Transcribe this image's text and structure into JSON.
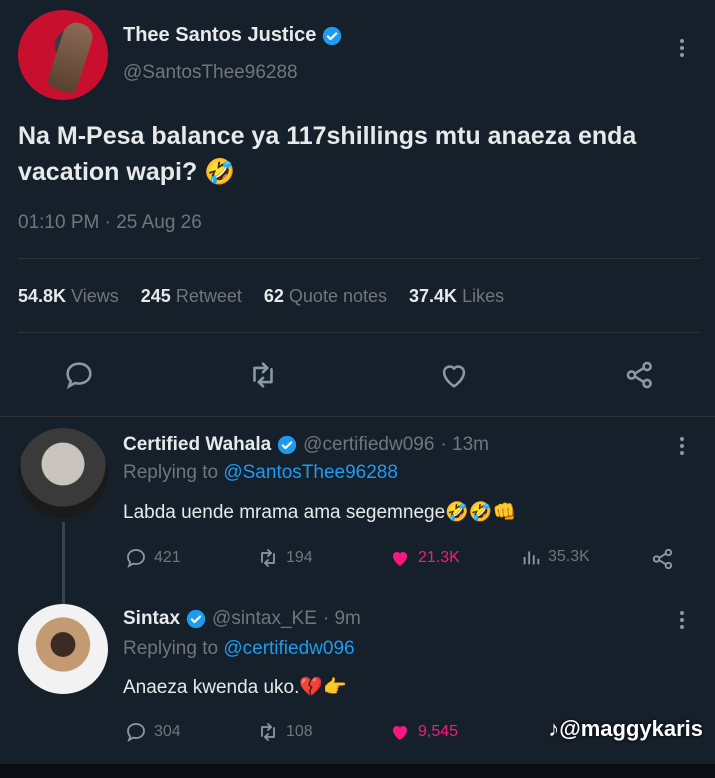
{
  "main_tweet": {
    "author_name": "Thee Santos Justice",
    "author_handle": "@SantosThee96288",
    "text_line1": "Na M-Pesa balance ya 117shillings mtu anaeza enda",
    "text_line2": "vacation wapi?",
    "emoji": "🤣",
    "timestamp": "01:10 PM · 25 Aug 26",
    "stats": [
      {
        "value": "54.8K",
        "label": "Views"
      },
      {
        "value": "245",
        "label": "Retweet"
      },
      {
        "value": "62",
        "label": "Quote notes"
      },
      {
        "value": "37.4K",
        "label": "Likes"
      }
    ],
    "icons": [
      "reply-icon",
      "retweet-icon",
      "like-icon",
      "share-icon"
    ]
  },
  "replies": [
    {
      "name": "Certified Wahala",
      "handle": "@certifiedw096",
      "time": "· 13m",
      "replying_label": "Replying to",
      "replying_to": "@SantosThee96288",
      "text": "Labda uende mrama ama segemnege",
      "emojis": "🤣🤣👊",
      "replies": "421",
      "retweets": "194",
      "likes": "21.3K",
      "views": "35.3K"
    },
    {
      "name": "Sintax",
      "handle": "@sintax_KE",
      "time": "· 9m",
      "replying_label": "Replying to",
      "replying_to": "@certifiedw096",
      "text": "Anaeza kwenda uko.",
      "emojis": "💔👉",
      "replies": "304",
      "retweets": "108",
      "likes": "9,545"
    }
  ],
  "watermark": "@maggykaris",
  "colors": {
    "background": "#15202b",
    "accent": "#1d9bf0",
    "like": "#f91880",
    "muted": "#71767b"
  }
}
